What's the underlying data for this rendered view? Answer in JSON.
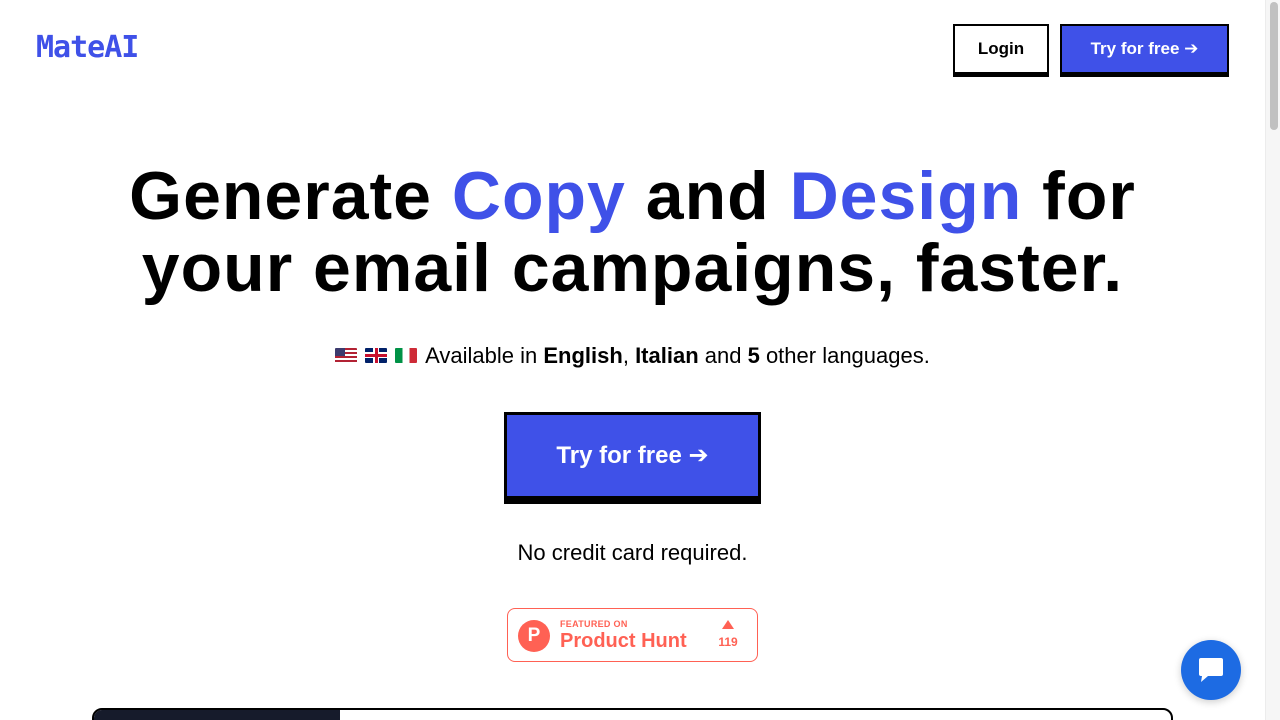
{
  "header": {
    "logo": "MateAI",
    "login_label": "Login",
    "try_label": "Try for free ➔"
  },
  "hero": {
    "title_part1": "Generate ",
    "title_accent1": "Copy",
    "title_part2": " and ",
    "title_accent2": "Design",
    "title_part3": " for",
    "title_line2": "your email campaigns, faster.",
    "languages_prefix": "Available in ",
    "language_1": "English",
    "languages_sep": ", ",
    "language_2": "Italian",
    "languages_mid": " and ",
    "other_count": "5",
    "languages_suffix": " other languages.",
    "cta_label": "Try for free ➔",
    "no_credit": "No credit card required."
  },
  "product_hunt": {
    "featured": "FEATURED ON",
    "name": "Product Hunt",
    "logo_letter": "P",
    "upvotes": "119"
  },
  "colors": {
    "accent": "#3f51e8",
    "product_hunt": "#ff6154",
    "chat": "#1d6be3"
  },
  "icons": {
    "flags": [
      "us-flag-icon",
      "uk-flag-icon",
      "italy-flag-icon"
    ],
    "chat": "chat-bubble-icon"
  }
}
